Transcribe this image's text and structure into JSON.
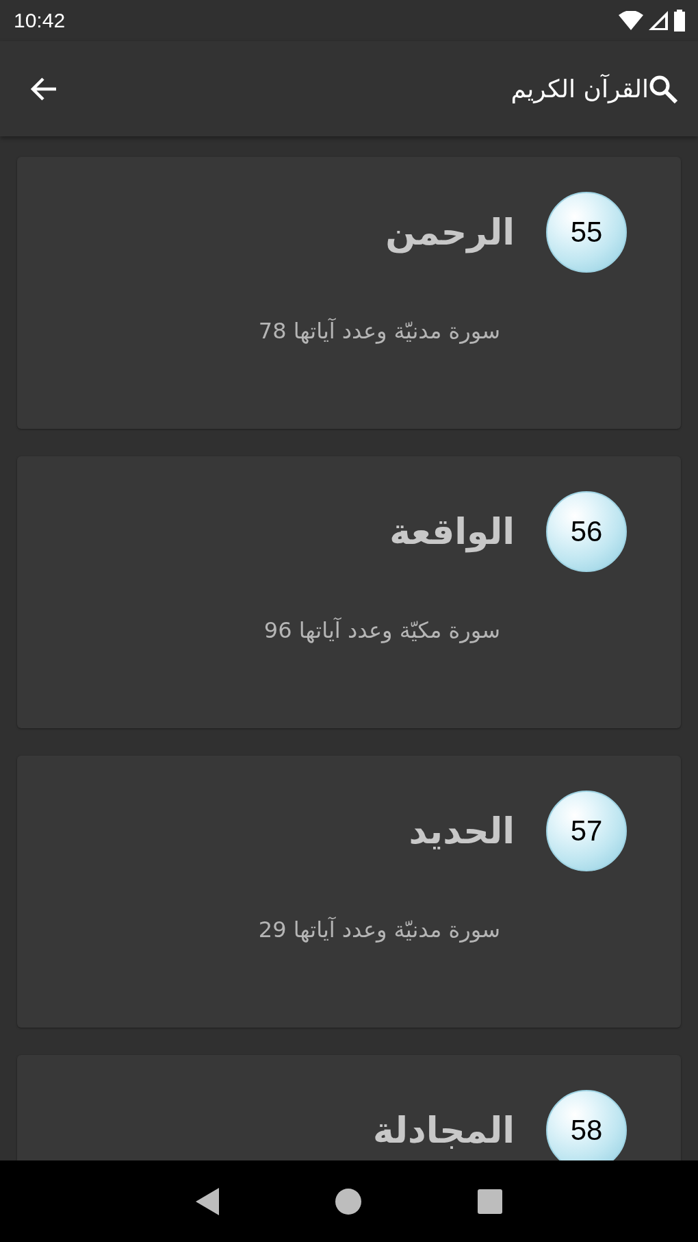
{
  "status_bar": {
    "time": "10:42"
  },
  "app_bar": {
    "title": "القرآن الكريم"
  },
  "surahs": [
    {
      "number": "55",
      "name": "الرحمن",
      "info": "سورة مدنيّة وعدد آياتها 78"
    },
    {
      "number": "56",
      "name": "الواقعة",
      "info": "سورة مكيّة وعدد آياتها 96"
    },
    {
      "number": "57",
      "name": "الحديد",
      "info": "سورة مدنيّة وعدد آياتها 29"
    },
    {
      "number": "58",
      "name": "المجادلة"
    }
  ]
}
